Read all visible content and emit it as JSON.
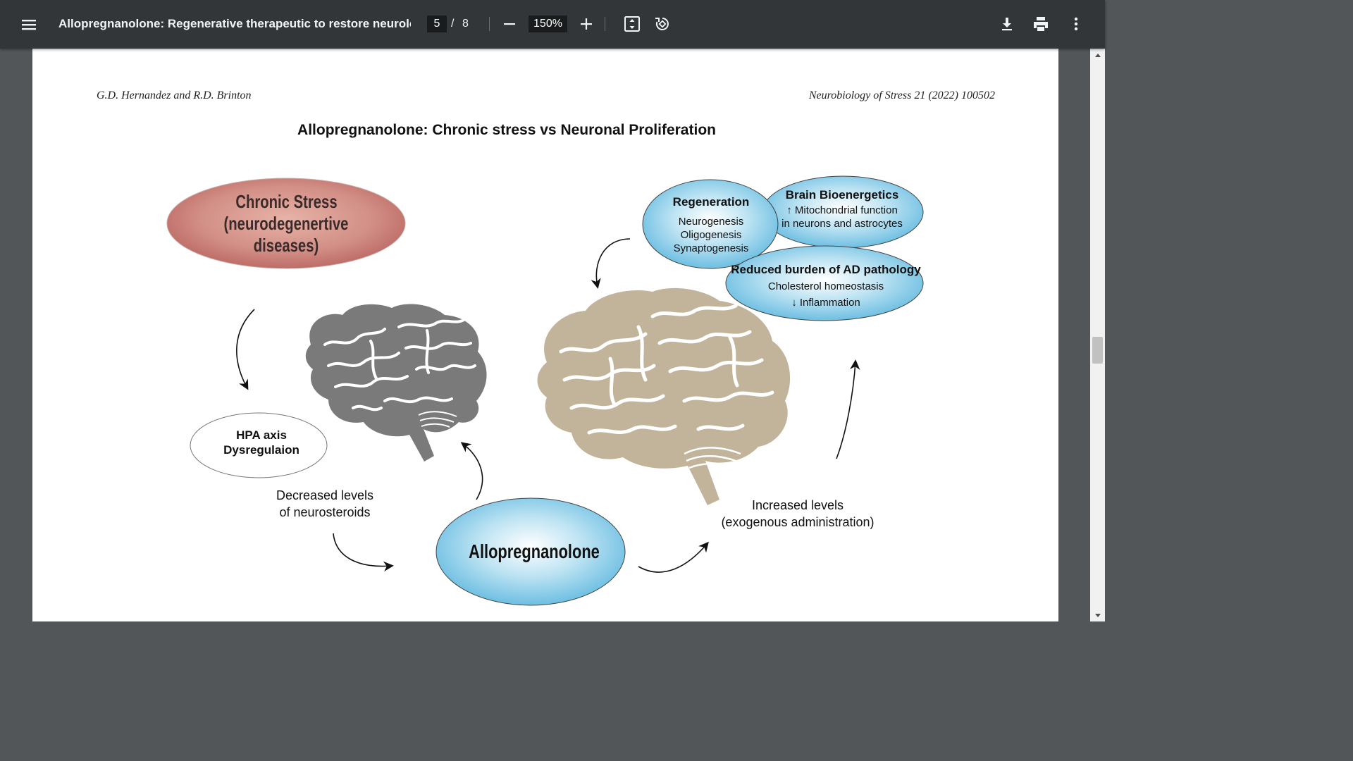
{
  "toolbar": {
    "menu_icon": "hamburger-menu-icon",
    "title": "Allopregnanolone: Regenerative therapeutic to restore neurolog...",
    "page_current": "5",
    "page_separator": "/",
    "page_total": "8",
    "zoom_out_icon": "minus-icon",
    "zoom_level": "150%",
    "zoom_in_icon": "plus-icon",
    "fit_icon": "fit-to-page-icon",
    "rotate_icon": "rotate-counterclockwise-icon",
    "download_icon": "download-icon",
    "print_icon": "print-icon",
    "more_icon": "more-vertical-icon"
  },
  "page": {
    "header_left": "G.D. Hernandez and R.D. Brinton",
    "header_right": "Neurobiology of Stress 21 (2022) 100502",
    "figure_title": "Allopregnanolone: Chronic stress vs Neuronal Proliferation"
  },
  "figure": {
    "chronic_stress_line1": "Chronic Stress",
    "chronic_stress_line2": "(neurodegenertive diseases)",
    "hpa_line1": "HPA axis",
    "hpa_line2": "Dysregulaion",
    "decreased_line1": "Decreased levels",
    "decreased_line2": "of neurosteroids",
    "allopregnanolone": "Allopregnanolone",
    "increased_line1": "Increased levels",
    "increased_line2": "(exogenous administration)",
    "regeneration_title": "Regeneration",
    "regeneration_items": [
      "Neurogenesis",
      "Oligogenesis",
      "Synaptogenesis"
    ],
    "bioenergetics_title": "Brain Bioenergetics",
    "bioenergetics_line1": "Mitochondrial function",
    "bioenergetics_line2": "in neurons and astrocytes",
    "bioenergetics_arrow": "↑",
    "ad_title": "Reduced burden of AD pathology",
    "ad_line1": "Cholesterol homeostasis",
    "ad_line2": "Inflammation",
    "ad_arrow": "↓"
  },
  "colors": {
    "toolbar_bg": "#323639",
    "viewer_bg": "#525659",
    "stress_ellipse": "#c97d77",
    "blue_ellipse": "#6cc2e4",
    "left_brain": "#7a7a7a",
    "right_brain": "#c2b49b"
  }
}
